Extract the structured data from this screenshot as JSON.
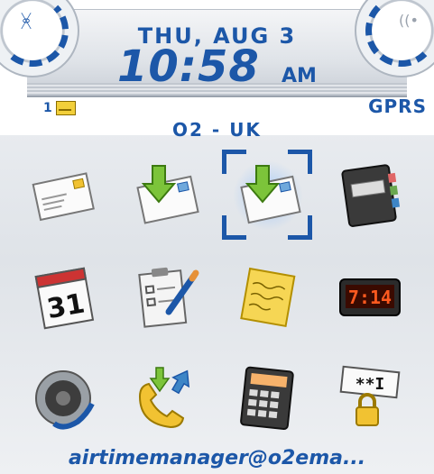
{
  "status_bar": {
    "date": "THU, AUG 3",
    "time": "10:58",
    "ampm": "AM",
    "message_count": "1",
    "network_type": "GPRS",
    "carrier": "O2 - UK"
  },
  "icons": [
    {
      "name": "messages",
      "icon": "envelope-icon"
    },
    {
      "name": "saved-messages",
      "icon": "envelope-download-icon"
    },
    {
      "name": "saved-messages-selected",
      "icon": "envelope-download-icon",
      "selected": true
    },
    {
      "name": "address-book",
      "icon": "address-book-icon"
    },
    {
      "name": "calendar",
      "icon": "calendar-icon",
      "label": "31"
    },
    {
      "name": "tasks",
      "icon": "clipboard-pen-icon"
    },
    {
      "name": "memopad",
      "icon": "memo-note-icon"
    },
    {
      "name": "clock",
      "icon": "digital-clock-icon",
      "label": "7:14"
    },
    {
      "name": "profiles",
      "icon": "speaker-icon"
    },
    {
      "name": "call-log",
      "icon": "phone-arrows-icon"
    },
    {
      "name": "calculator",
      "icon": "calculator-icon"
    },
    {
      "name": "password-keeper",
      "icon": "password-lock-icon",
      "label": "**I"
    }
  ],
  "footer": {
    "account": "airtimemanager@o2ema..."
  },
  "colors": {
    "accent": "#1c57a8",
    "background": "#e4e7eb"
  }
}
